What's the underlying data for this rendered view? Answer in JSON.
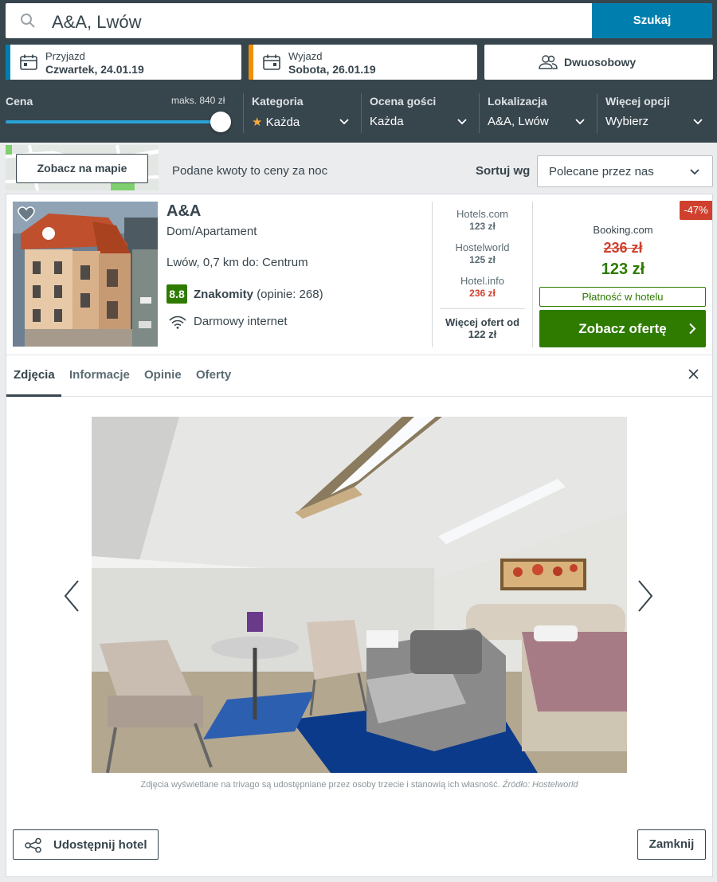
{
  "search": {
    "query": "A&A, Lwów",
    "button_label": "Szukaj"
  },
  "dates": {
    "checkin": {
      "label": "Przyjazd",
      "value": "Czwartek, 24.01.19"
    },
    "checkout": {
      "label": "Wyjazd",
      "value": "Sobota, 26.01.19"
    }
  },
  "room": {
    "value": "Dwuosobowy"
  },
  "filters": {
    "price": {
      "label": "Cena",
      "max_label": "maks. 840 zł",
      "slider_fraction": 1.0
    },
    "category": {
      "label": "Kategoria",
      "value": "Każda",
      "star": "★"
    },
    "guest_rating": {
      "label": "Ocena gości",
      "value": "Każda"
    },
    "location": {
      "label": "Lokalizacja",
      "value": "A&A, Lwów"
    },
    "more": {
      "label": "Więcej opcji",
      "value": "Wybierz"
    }
  },
  "results_bar": {
    "map_button": "Zobacz na mapie",
    "price_note": "Podane kwoty to ceny za noc",
    "sort_label": "Sortuj wg",
    "sort_value": "Polecane przez nas"
  },
  "hotel": {
    "name": "A&A",
    "type": "Dom/Apartament",
    "location": "Lwów, 0,7 km do: Centrum",
    "rating_score": "8.8",
    "rating_word": "Znakomity",
    "rating_count": "(opinie: 268)",
    "amenity": "Darmowy internet",
    "partners": [
      {
        "name": "Hotels.com",
        "price": "123 zł",
        "color": "#5b6b73"
      },
      {
        "name": "Hostelworld",
        "price": "125 zł",
        "color": "#5b6b73"
      },
      {
        "name": "Hotel.info",
        "price": "236 zł",
        "color": "#d0402e"
      }
    ],
    "more_offers_line1": "Więcej ofert od",
    "more_offers_line2": "122 zł",
    "deal": {
      "discount": "-47%",
      "site": "Booking.com",
      "old_price": "236 zł",
      "new_price": "123 zł",
      "payment": "Płatność w hotelu",
      "button": "Zobacz ofertę"
    }
  },
  "tabs": [
    {
      "label": "Zdjęcia",
      "active": true
    },
    {
      "label": "Informacje",
      "active": false
    },
    {
      "label": "Opinie",
      "active": false
    },
    {
      "label": "Oferty",
      "active": false
    }
  ],
  "gallery": {
    "caption": "Zdjęcia wyświetlane na trivago są udostępniane przez osoby trzecie i stanowią ich własność.",
    "source": "Źródło: Hostelworld"
  },
  "footer": {
    "share_button": "Udostępnij hotel",
    "close_button": "Zamknij"
  },
  "colors": {
    "header_bg": "#37454d",
    "search_button": "#007faf",
    "checkin_accent": "#007faf",
    "checkout_accent": "#f48f00",
    "deal_green": "#2e7b00",
    "discount_red": "#d0402e"
  }
}
